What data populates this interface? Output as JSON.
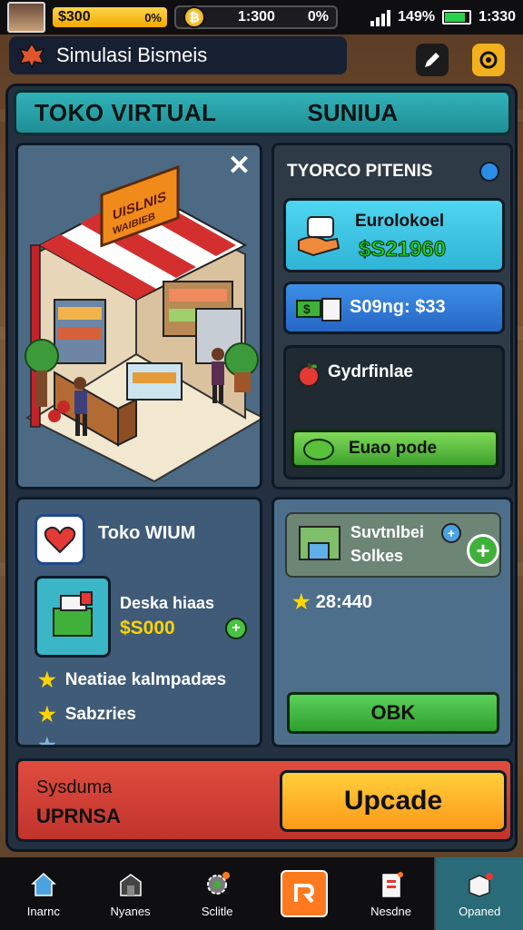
{
  "status_bar": {
    "money": "$300",
    "money_badge": "0%",
    "time_left": "1:300",
    "time_right": "0%",
    "battery_pct": "149%",
    "clock": "1:330"
  },
  "title_bar": {
    "title": "Simulasi Bismeis",
    "icons": [
      "leaf-icon",
      "pen-icon",
      "target-icon"
    ]
  },
  "banner": {
    "left": "TOKO VIRTUAL",
    "right": "SUNIUA"
  },
  "store_panel": {
    "sign_line1": "UISLNIS",
    "sign_line2": "WAIBIEB"
  },
  "status_panel": {
    "heading": "TYORCO PITENIS",
    "card1_label": "Eurolokoel",
    "card1_value": "$S21960",
    "card2_label": "S09ng: $33",
    "card3_label": "Gydrfinlae",
    "card3_button": "Euao pode"
  },
  "toko_panel": {
    "title": "Toko WIUM",
    "item_name": "Deska hiaas",
    "item_price": "$S000",
    "rows": [
      "Neatiae kalmpadæs",
      "Sabzries",
      "..."
    ]
  },
  "supplies_panel": {
    "line1": "Suvtnlbei",
    "line2": "Solkes",
    "score": "28:440",
    "ok_button": "OBK"
  },
  "upgrade_bar": {
    "label_top": "Sysduma",
    "label_bottom": "UPRNSA",
    "button": "Upcade"
  },
  "bottom_nav": [
    {
      "label": "Inarnc",
      "icon": "home-icon"
    },
    {
      "label": "Nyanes",
      "icon": "shop-icon"
    },
    {
      "label": "Sclitle",
      "icon": "gear-icon"
    },
    {
      "label": "",
      "icon": "r-badge-icon"
    },
    {
      "label": "Nesdne",
      "icon": "clipboard-icon"
    },
    {
      "label": "Opaned",
      "icon": "box-icon"
    }
  ],
  "colors": {
    "teal_banner": "#31b2b8",
    "green_button": "#3fa22e",
    "upgrade_red": "#c0342c",
    "upgrade_orange": "#ffb02a"
  }
}
